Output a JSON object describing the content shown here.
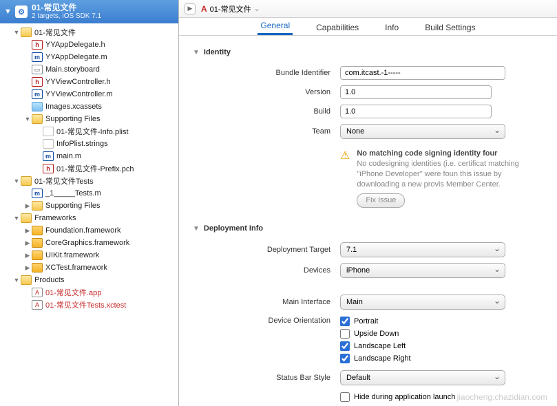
{
  "project": {
    "name": "01-常见文件",
    "subtitle": "2 targets, iOS SDK 7.1"
  },
  "tree": [
    {
      "d": 1,
      "k": "folder",
      "tw": "▼",
      "label": "01-常见文件"
    },
    {
      "d": 2,
      "k": "h",
      "label": "YYAppDelegate.h"
    },
    {
      "d": 2,
      "k": "m",
      "label": "YYAppDelegate.m"
    },
    {
      "d": 2,
      "k": "sb",
      "label": "Main.storyboard"
    },
    {
      "d": 2,
      "k": "h",
      "label": "YYViewController.h"
    },
    {
      "d": 2,
      "k": "m",
      "label": "YYViewController.m"
    },
    {
      "d": 2,
      "k": "img",
      "label": "Images.xcassets"
    },
    {
      "d": 2,
      "k": "folder",
      "tw": "▼",
      "label": "Supporting Files"
    },
    {
      "d": 3,
      "k": "txt",
      "label": "01-常见文件-Info.plist"
    },
    {
      "d": 3,
      "k": "txt",
      "label": "InfoPlist.strings"
    },
    {
      "d": 3,
      "k": "m",
      "label": "main.m"
    },
    {
      "d": 3,
      "k": "h",
      "label": "01-常见文件-Prefix.pch"
    },
    {
      "d": 1,
      "k": "folder",
      "tw": "▼",
      "label": "01-常见文件Tests"
    },
    {
      "d": 2,
      "k": "m",
      "label": "_1_____Tests.m"
    },
    {
      "d": 2,
      "k": "folder",
      "tw": "▶",
      "label": "Supporting Files"
    },
    {
      "d": 1,
      "k": "folder",
      "tw": "▼",
      "label": "Frameworks"
    },
    {
      "d": 2,
      "k": "fw",
      "tw": "▶",
      "label": "Foundation.framework"
    },
    {
      "d": 2,
      "k": "fw",
      "tw": "▶",
      "label": "CoreGraphics.framework"
    },
    {
      "d": 2,
      "k": "fw",
      "tw": "▶",
      "label": "UIKit.framework"
    },
    {
      "d": 2,
      "k": "fw",
      "tw": "▶",
      "label": "XCTest.framework"
    },
    {
      "d": 1,
      "k": "folder",
      "tw": "▼",
      "label": "Products"
    },
    {
      "d": 2,
      "k": "app",
      "label": "01-常见文件.app",
      "red": true
    },
    {
      "d": 2,
      "k": "app",
      "label": "01-常见文件Tests.xctest",
      "red": true
    }
  ],
  "breadcrumb": {
    "item": "01-常见文件"
  },
  "tabs": {
    "t0": "General",
    "t1": "Capabilities",
    "t2": "Info",
    "t3": "Build Settings"
  },
  "identity": {
    "title": "Identity",
    "bundle_label": "Bundle Identifier",
    "bundle_value": "com.itcast.-1-----",
    "version_label": "Version",
    "version_value": "1.0",
    "build_label": "Build",
    "build_value": "1.0",
    "team_label": "Team",
    "team_value": "None",
    "warn_bold": "No matching code signing identity four",
    "warn_body": "No codesigning identities (i.e. certificat matching \"iPhone Developer\" were foun this issue by downloading a new provis Member Center.",
    "fix": "Fix Issue"
  },
  "deploy": {
    "title": "Deployment Info",
    "target_label": "Deployment Target",
    "target_value": "7.1",
    "devices_label": "Devices",
    "devices_value": "iPhone",
    "main_label": "Main Interface",
    "main_value": "Main",
    "orient_label": "Device Orientation",
    "o_portrait": "Portrait",
    "o_upside": "Upside Down",
    "o_left": "Landscape Left",
    "o_right": "Landscape Right",
    "status_label": "Status Bar Style",
    "status_value": "Default",
    "hide": "Hide during application launch"
  },
  "icon_letters": {
    "h": "h",
    "m": "m",
    "sb": "▭",
    "txt": "",
    "img": "",
    "fw": "",
    "app": "A",
    "folder": "",
    "folder-proj": ""
  }
}
